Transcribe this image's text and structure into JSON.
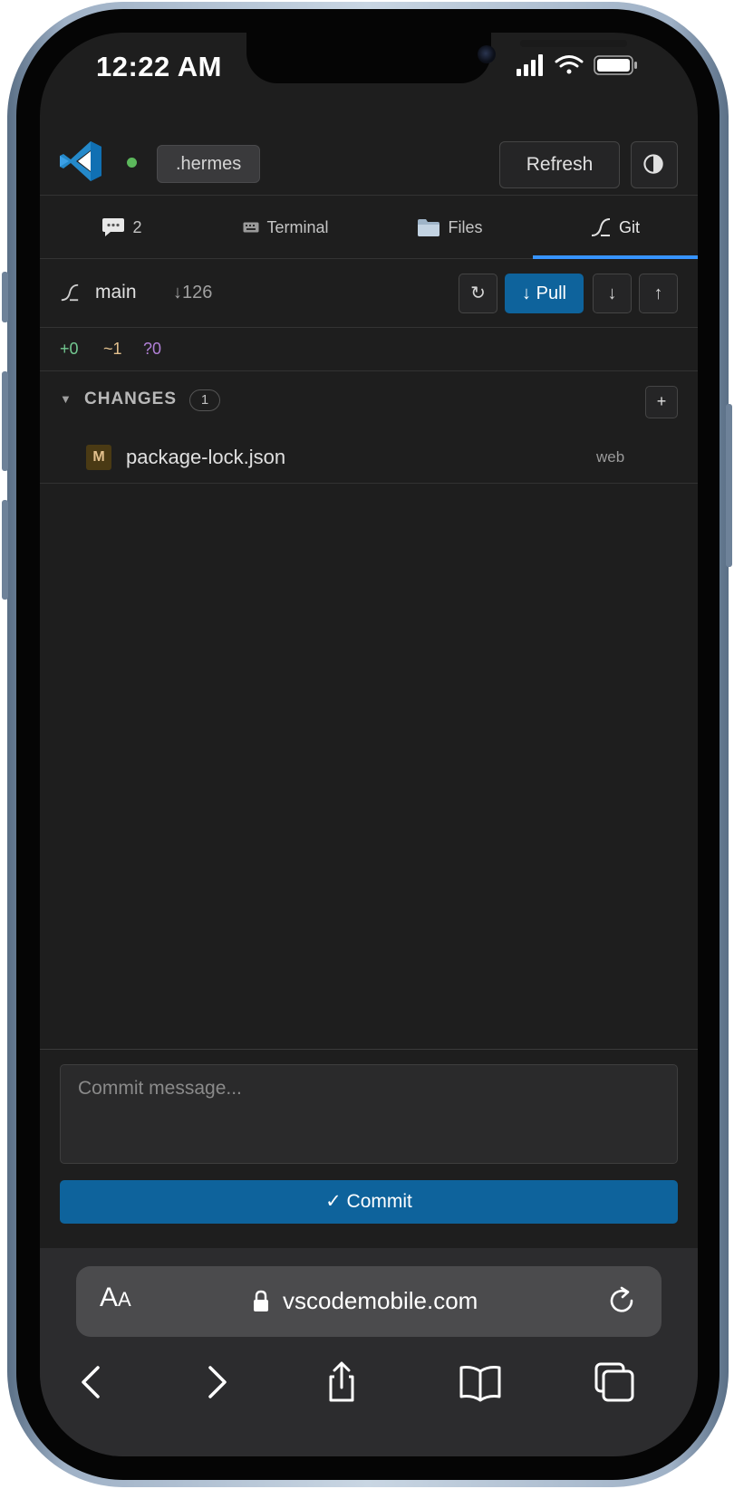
{
  "status_bar": {
    "time": "12:22 AM"
  },
  "header": {
    "workspace": ".hermes",
    "refresh_label": "Refresh"
  },
  "tabs": [
    {
      "icon": "chat-bubble-icon",
      "label": "2"
    },
    {
      "icon": "keyboard-icon",
      "label": "Terminal"
    },
    {
      "icon": "folder-icon",
      "label": "Files"
    },
    {
      "icon": "git-branch-icon",
      "label": "Git",
      "active": true
    }
  ],
  "git": {
    "branch": "main",
    "behind": "↓126",
    "sync_label": "↻",
    "pull_label": "↓ Pull",
    "fetch_label": "↓",
    "push_label": "↑",
    "counts": {
      "added": "+0",
      "modified": "~1",
      "untracked": "?0"
    },
    "changes_title": "CHANGES",
    "changes_count": "1",
    "stage_all_label": "+",
    "files": [
      {
        "status": "M",
        "name": "package-lock.json",
        "dir": "web"
      }
    ],
    "commit_placeholder": "Commit message...",
    "commit_label": "✓ Commit"
  },
  "browser": {
    "aa_big": "A",
    "aa_small": "A",
    "url": "vscodemobile.com"
  },
  "colors": {
    "accent": "#0e639c",
    "tab_underline": "#3794ff",
    "added": "#73c991",
    "modified": "#e2c08d",
    "untracked": "#b180d7",
    "connected": "#5cb85c"
  }
}
